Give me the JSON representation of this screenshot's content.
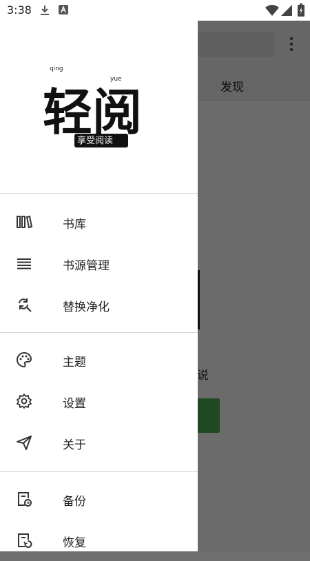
{
  "status_bar": {
    "time": "3:38",
    "icons": [
      "download-icon",
      "a-badge-icon",
      "wifi-icon",
      "signal-icon",
      "battery-charging-icon"
    ]
  },
  "underlay": {
    "tab_label": "发现",
    "empty_text_partial": "说"
  },
  "drawer": {
    "logo_text": "轻阅",
    "logo_pinyin_1": "qing",
    "logo_pinyin_2": "yue",
    "logo_stamp": "享受阅读",
    "groups": [
      {
        "items": [
          {
            "label": "书库",
            "icon": "bookshelf-icon"
          },
          {
            "label": "书源管理",
            "icon": "list-icon"
          },
          {
            "label": "替换净化",
            "icon": "find-replace-icon"
          }
        ]
      },
      {
        "items": [
          {
            "label": "主题",
            "icon": "palette-icon"
          },
          {
            "label": "设置",
            "icon": "gear-icon"
          },
          {
            "label": "关于",
            "icon": "send-icon"
          }
        ]
      },
      {
        "items": [
          {
            "label": "备份",
            "icon": "backup-icon"
          },
          {
            "label": "恢复",
            "icon": "restore-icon"
          }
        ]
      }
    ]
  },
  "colors": {
    "scrim": "#000000",
    "accent_green": "#4caf50",
    "icon": "#333333"
  }
}
